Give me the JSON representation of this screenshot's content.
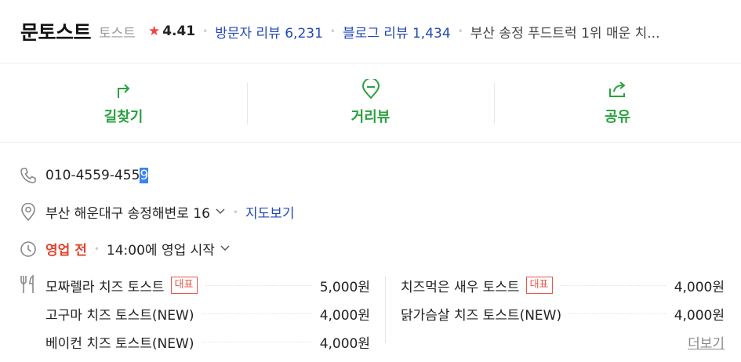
{
  "header": {
    "name": "문토스트",
    "category": "토스트",
    "rating": "4.41",
    "visitor_reviews": "방문자 리뷰 6,231",
    "blog_reviews": "블로그 리뷰 1,434",
    "description": "부산 송정 푸드트럭 1위 매운 치..."
  },
  "actions": [
    {
      "label": "길찾기",
      "icon": "directions-icon"
    },
    {
      "label": "거리뷰",
      "icon": "street-view-icon"
    },
    {
      "label": "공유",
      "icon": "share-icon"
    }
  ],
  "info": {
    "phone_prefix": "010-4559-455",
    "phone_selected": "9",
    "address": "부산 해운대구 송정해변로 16",
    "map_link": "지도보기",
    "status": "영업 전",
    "hours": "14:00에 영업 시작"
  },
  "menu": {
    "left": [
      {
        "name": "모짜렐라 치즈 토스트",
        "badge": "대표",
        "price": "5,000원"
      },
      {
        "name": "고구마 치즈 토스트(NEW)",
        "badge": "",
        "price": "4,000원"
      },
      {
        "name": "베이컨 치즈 토스트(NEW)",
        "badge": "",
        "price": "4,000원"
      }
    ],
    "right": [
      {
        "name": "치즈먹은 새우 토스트",
        "badge": "대표",
        "price": "4,000원"
      },
      {
        "name": "닭가슴살 치즈 토스트(NEW)",
        "badge": "",
        "price": "4,000원"
      }
    ],
    "more_label": "더보기"
  },
  "colors": {
    "accent_green": "#2aa140",
    "link_blue": "#224ab6",
    "status_red": "#e0432c"
  }
}
